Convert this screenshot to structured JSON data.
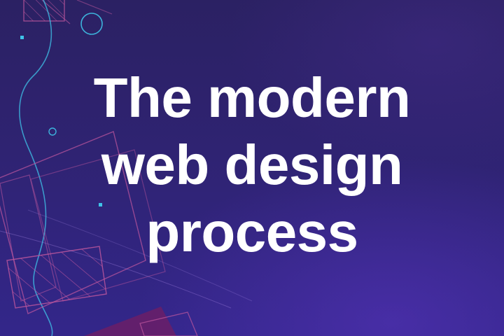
{
  "hero": {
    "title_lines": [
      "The modern",
      "web design",
      "process"
    ]
  },
  "colors": {
    "background_top": "#2b2163",
    "background_bottom": "#33268a",
    "title_text": "#ffffff",
    "accent_cyan": "#3fc3e8",
    "accent_pink": "#c0579e",
    "accent_magenta": "#6b1f67"
  },
  "decorations": {
    "icons": [
      "wavy-line-icon",
      "circle-outline-icon",
      "hatched-rectangle-icon",
      "square-dot-icon"
    ]
  }
}
